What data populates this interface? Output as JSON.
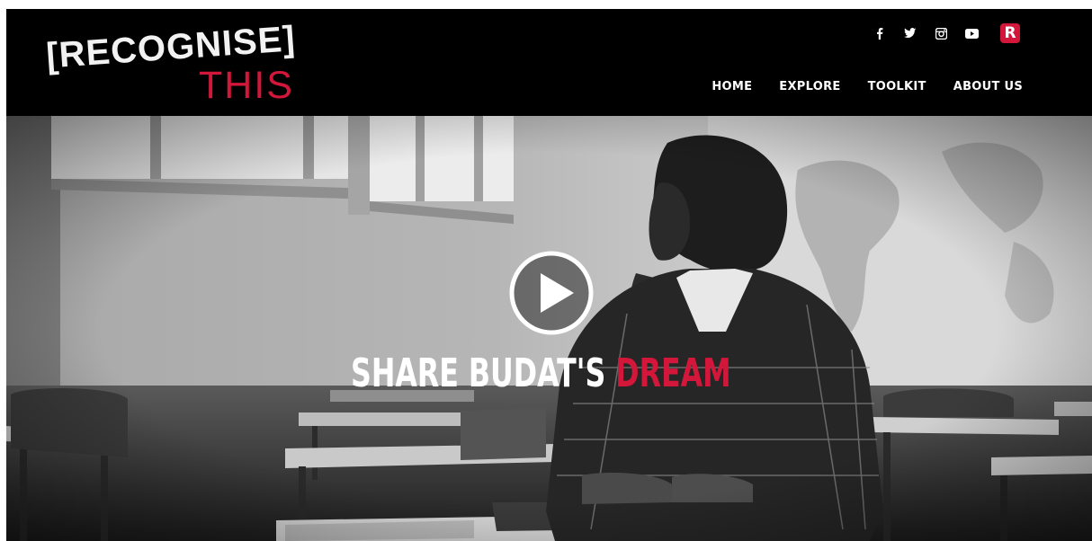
{
  "brand": {
    "logo_text_top": "[RECOGNISE]",
    "logo_text_bottom": "THIS",
    "accent_color": "#d2173b"
  },
  "social": [
    {
      "name": "facebook-icon",
      "glyph": "f"
    },
    {
      "name": "twitter-icon",
      "glyph": "bird"
    },
    {
      "name": "instagram-icon",
      "glyph": "camera"
    },
    {
      "name": "youtube-icon",
      "glyph": "play"
    },
    {
      "name": "recognise-r-icon",
      "glyph": "R"
    }
  ],
  "nav": {
    "home": "HOME",
    "explore": "EXPLORE",
    "toolkit": "TOOLKIT",
    "about": "ABOUT US"
  },
  "hero": {
    "headline_main": "SHARE BUDAT'S ",
    "headline_accent": "DREAM",
    "play_icon": "play-circle-icon"
  }
}
